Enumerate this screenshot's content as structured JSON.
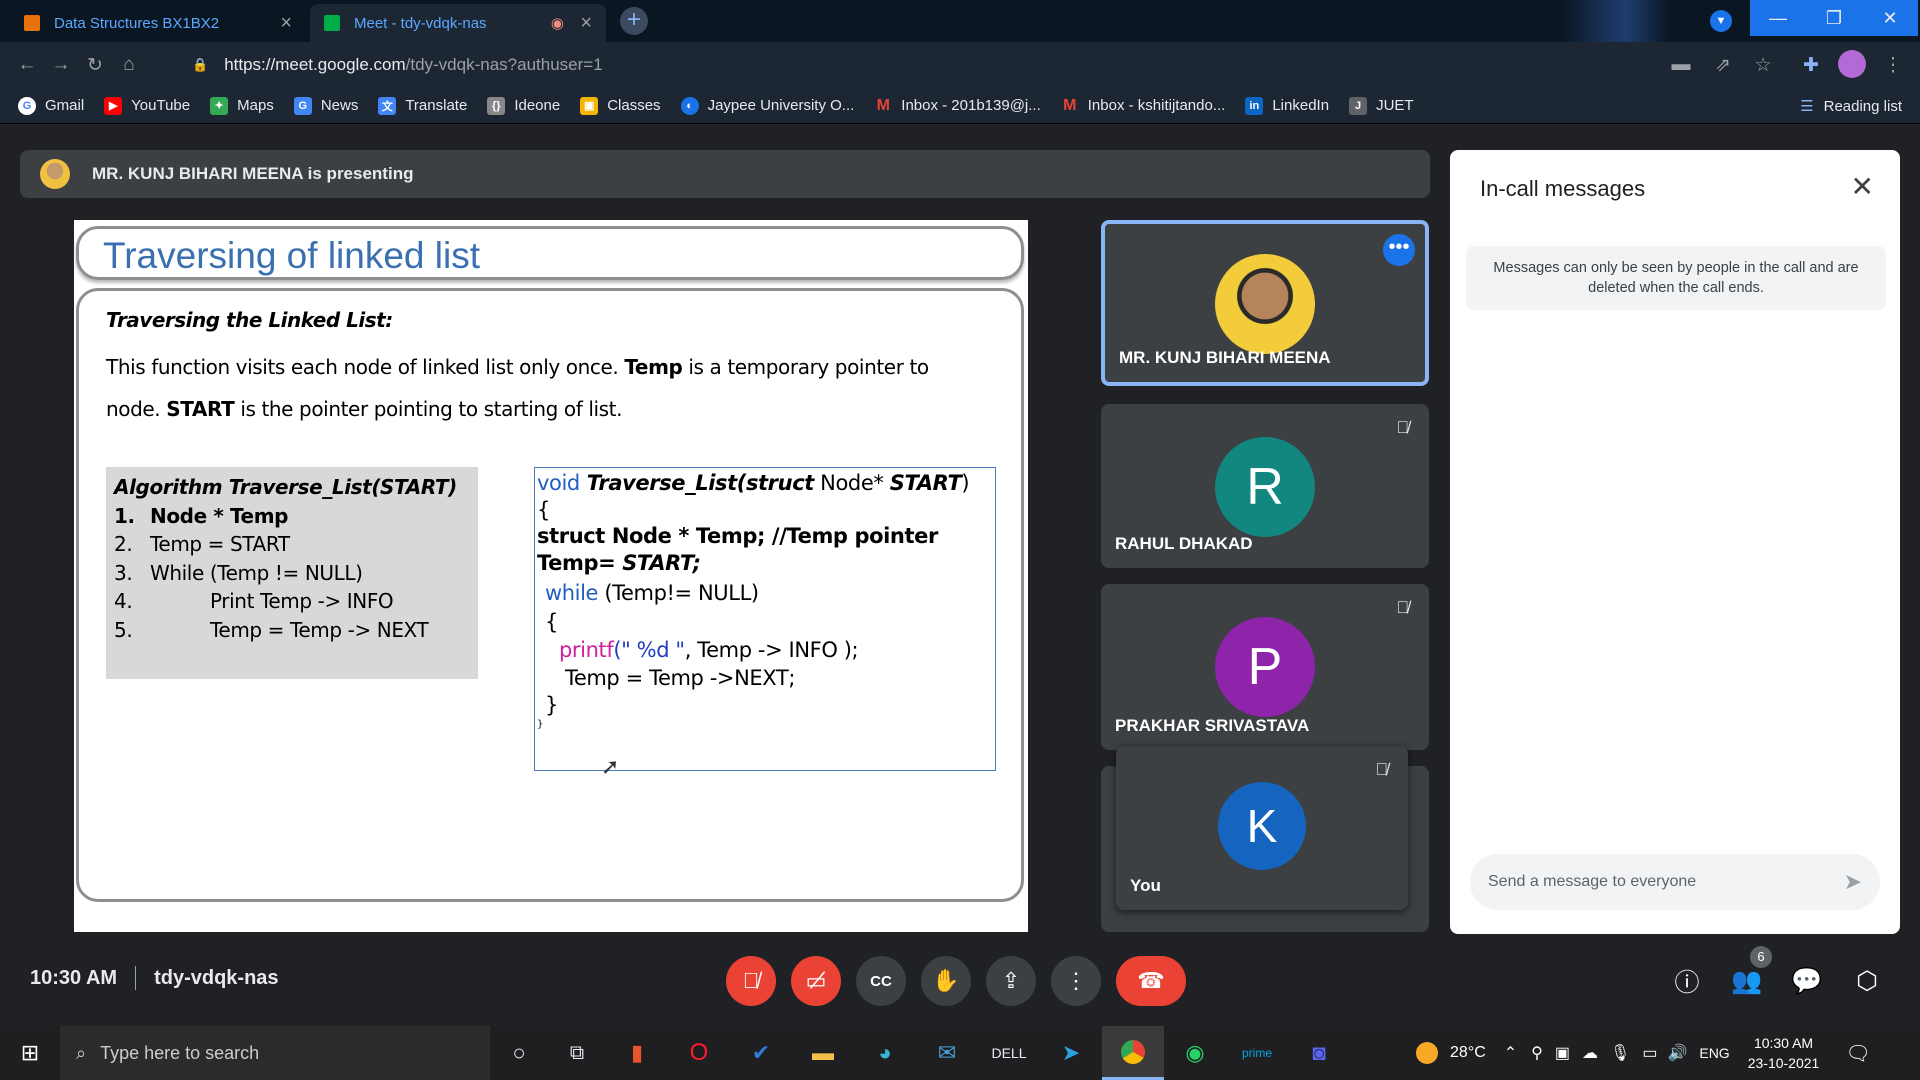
{
  "browser": {
    "tabs": [
      {
        "title": "Data Structures BX1BX2",
        "color": "#e8710a"
      },
      {
        "title": "Meet - tdy-vdqk-nas",
        "color": "#00ac47"
      }
    ],
    "new_tab": "+",
    "url_host": "https://meet.google.com",
    "url_rest": "/tdy-vdqk-nas?authuser=1",
    "bookmarks": [
      {
        "label": "Gmail",
        "icon": "google-icon",
        "color": "#ffffff"
      },
      {
        "label": "YouTube",
        "icon": "youtube-icon",
        "color": "#ff0000"
      },
      {
        "label": "Maps",
        "icon": "maps-icon",
        "color": "#34a853"
      },
      {
        "label": "News",
        "icon": "news-icon",
        "color": "#4285f4"
      },
      {
        "label": "Translate",
        "icon": "translate-icon",
        "color": "#4285f4"
      },
      {
        "label": "Ideone",
        "icon": "ideone-icon",
        "color": "#888888"
      },
      {
        "label": "Classes",
        "icon": "classroom-icon",
        "color": "#f4b400"
      },
      {
        "label": "Jaypee University O...",
        "icon": "globe-icon",
        "color": "#1a73e8"
      },
      {
        "label": "Inbox - 201b139@j...",
        "icon": "gmail-icon",
        "color": "#ea4335"
      },
      {
        "label": "Inbox - kshitijtando...",
        "icon": "gmail-icon",
        "color": "#ea4335"
      },
      {
        "label": "LinkedIn",
        "icon": "linkedin-icon",
        "color": "#0a66c2"
      },
      {
        "label": "JUET",
        "icon": "juet-icon",
        "color": "#5f6368"
      }
    ],
    "reading_list": "Reading list"
  },
  "meet": {
    "presenting": "MR. KUNJ BIHARI MEENA is presenting",
    "slide": {
      "title": "Traversing of linked list",
      "subtitle": "Traversing the Linked List:",
      "para1_a": "This function visits each node of linked list only once. ",
      "para1_b": "Temp",
      "para1_c": " is a temporary pointer to",
      "para2_a": "node. ",
      "para2_b": "START",
      "para2_c": " is the pointer pointing to starting of list.",
      "algo_heading": "Algorithm Traverse_List(START)",
      "algo_steps": [
        {
          "num": "1.",
          "text": "Node *  Temp"
        },
        {
          "num": "2.",
          "text": "Temp = START"
        },
        {
          "num": "3.",
          "text": "While (Temp != NULL)"
        },
        {
          "num": "4.",
          "text": "Print Temp -> INFO"
        },
        {
          "num": "5.",
          "text": "Temp = Temp -> NEXT"
        }
      ],
      "code": {
        "l1_kw": "void",
        "l1_fn": " Traverse_List(struct",
        "l1_rest": " Node* ",
        "l1_arg": "START",
        "l1_end": ")",
        "l2": "{",
        "l3": " struct Node * Temp; //Temp pointer",
        "l4_a": "Temp= ",
        "l4_b": "START;",
        "l5_kw": "while",
        "l5_rest": " (Temp!= NULL)",
        "l6": "{",
        "l7_fn": "printf",
        "l7_str": "(\" %d \"",
        "l7_rest": ", Temp -> INFO );",
        "l8": "Temp = Temp ->NEXT;",
        "l9": "}",
        "l10": "}"
      }
    },
    "participants": [
      {
        "name": "MR. KUNJ BIHARI MEENA",
        "initial": "",
        "color": "#f0c040",
        "muted": false
      },
      {
        "name": "RAHUL DHAKAD",
        "initial": "R",
        "color": "#12877f",
        "muted": true
      },
      {
        "name": "PRAKHAR SRIVASTAVA",
        "initial": "P",
        "color": "#8e24aa",
        "muted": true
      },
      {
        "name": "You",
        "initial": "K",
        "color": "#1565c0",
        "muted": true
      }
    ],
    "chat": {
      "title": "In-call messages",
      "info": "Messages can only be seen by people in the call and are deleted when the call ends.",
      "placeholder": "Send a message to everyone"
    },
    "bottom": {
      "time": "10:30 AM",
      "code": "tdy-vdqk-nas",
      "people_count": "6"
    }
  },
  "taskbar": {
    "search_placeholder": "Type here to search",
    "weather": "28°C",
    "lang": "ENG",
    "time": "10:30 AM",
    "date": "23-10-2021"
  }
}
